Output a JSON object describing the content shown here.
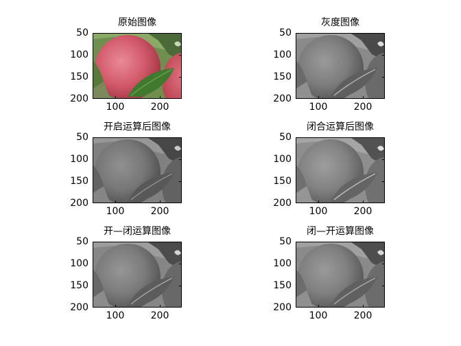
{
  "figure": {
    "panels": [
      {
        "id": "original",
        "title": "原始图像",
        "mode": "color"
      },
      {
        "id": "gray",
        "title": "灰度图像",
        "mode": "gray"
      },
      {
        "id": "open",
        "title": "开启运算后图像",
        "mode": "gray"
      },
      {
        "id": "close",
        "title": "闭合运算后图像",
        "mode": "gray"
      },
      {
        "id": "open-close",
        "title": "开—闭运算图像",
        "mode": "gray"
      },
      {
        "id": "close-open",
        "title": "闭—开运算图像",
        "mode": "gray"
      }
    ],
    "axis": {
      "yticks": [
        "50",
        "100",
        "150",
        "200"
      ],
      "xticks": [
        "100",
        "200"
      ]
    },
    "colors": {
      "apple_red": "#d35a6a",
      "leaf_green": "#3f7a2e",
      "background_green": "#7fa35f"
    }
  }
}
